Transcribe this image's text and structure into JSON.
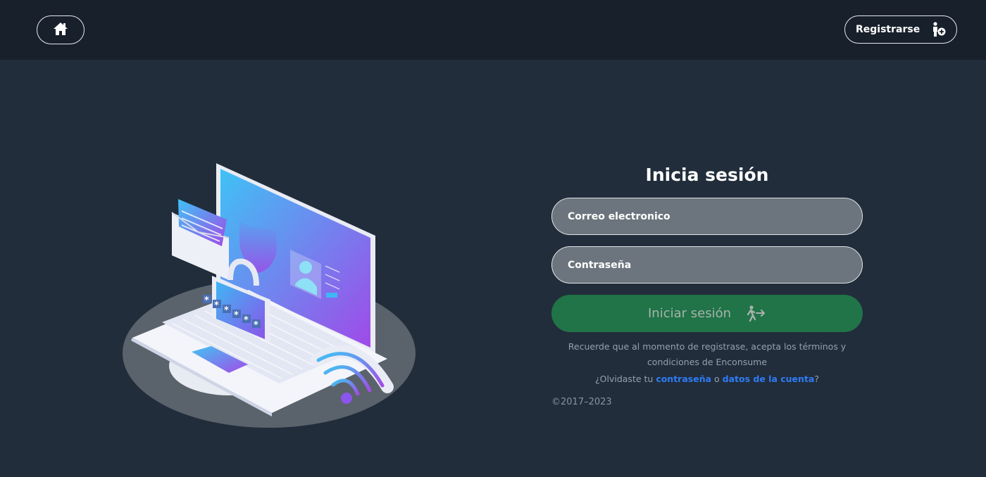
{
  "header": {
    "home_icon": "home-icon",
    "register_label": "Registrarse",
    "register_icon": "person-add-icon"
  },
  "illustration": {
    "description_icon": "laptop-security-illustration",
    "password_mask": "*****"
  },
  "login": {
    "title": "Inicia sesión",
    "email_placeholder": "Correo electronico",
    "password_placeholder": "Contraseña",
    "submit_label": "Iniciar sesión",
    "submit_icon": "walk-in-icon",
    "terms_text": "Recuerde que al momento de registrase, acepta los términos y condiciones de Enconsume",
    "forgot_prefix": "¿Olvidaste tu ",
    "forgot_link_password": "contraseña",
    "forgot_middle": " o ",
    "forgot_link_account": "datos de la cuenta",
    "forgot_suffix": "?",
    "copyright": "©2017–2023"
  },
  "colors": {
    "background": "#212d3b",
    "topbar": "#18202b",
    "field_bg": "#6c757d",
    "primary_button": "#207447",
    "link": "#2f7cf6"
  }
}
